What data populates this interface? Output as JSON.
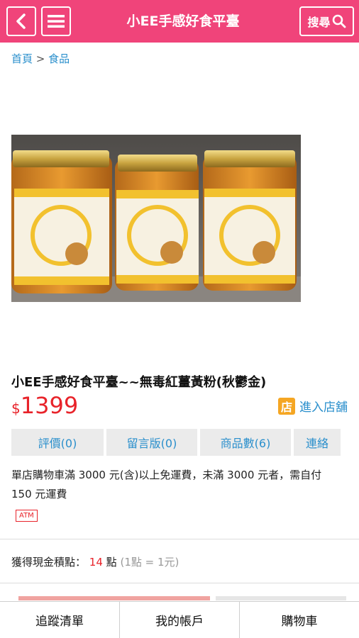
{
  "header": {
    "title": "小EE手感好食平臺",
    "search_label": "搜尋"
  },
  "breadcrumb": {
    "home": "首頁",
    "separator": ">",
    "category": "食品"
  },
  "product": {
    "title": "小EE手感好食平臺~~無毒紅薑黃粉(秋鬱金)",
    "price_currency": "$",
    "price_amount": "1399",
    "store_badge": "店",
    "store_link": "進入店舖"
  },
  "tabs": [
    {
      "label": "評價(0)"
    },
    {
      "label": "留言版(0)"
    },
    {
      "label": "商品數(6)"
    },
    {
      "label": "連絡"
    }
  ],
  "shipping_note": "單店購物車滿 3000 元(含)以上免運費，未滿 3000 元者，需自付 150 元運費",
  "payment_badge": "ATM",
  "points": {
    "label": "獲得現金積點：",
    "value": "14",
    "unit": "點",
    "note": "(1點 = 1元)"
  },
  "bottom_nav": [
    {
      "label": "追蹤清單"
    },
    {
      "label": "我的帳戶"
    },
    {
      "label": "購物車"
    }
  ],
  "colors": {
    "brand": "#f0447a",
    "price": "#e8232a",
    "link": "#2a8fcc",
    "store_badge": "#f5a623"
  }
}
